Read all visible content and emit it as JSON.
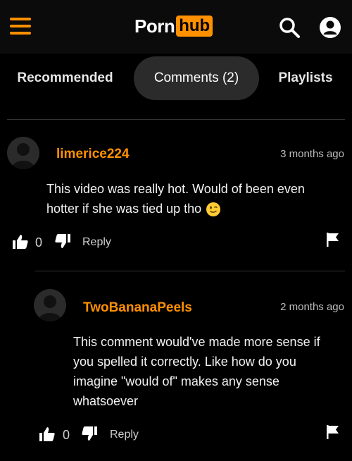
{
  "header": {
    "logo_part1": "Porn",
    "logo_part2": "hub",
    "accent": "#ff9000",
    "icons": [
      "hamburger-menu-icon",
      "search-icon",
      "user-icon"
    ]
  },
  "tabs": [
    {
      "label": "Recommended",
      "active": false
    },
    {
      "label": "Comments (2)",
      "active": true
    },
    {
      "label": "Playlists",
      "active": false
    }
  ],
  "comments": [
    {
      "username": "limerice224",
      "time": "3 months ago",
      "text": "This video was really hot. Would of been even hotter if she was tied up tho",
      "emoji": "winking-face",
      "likes": "0",
      "reply_label": "Reply"
    },
    {
      "username": "TwoBananaPeels",
      "time": "2 months ago",
      "text": "This comment would've made more sense if you spelled it correctly. Like how do you imagine \"would of\" makes any sense whatsoever",
      "likes": "0",
      "reply_label": "Reply"
    }
  ]
}
